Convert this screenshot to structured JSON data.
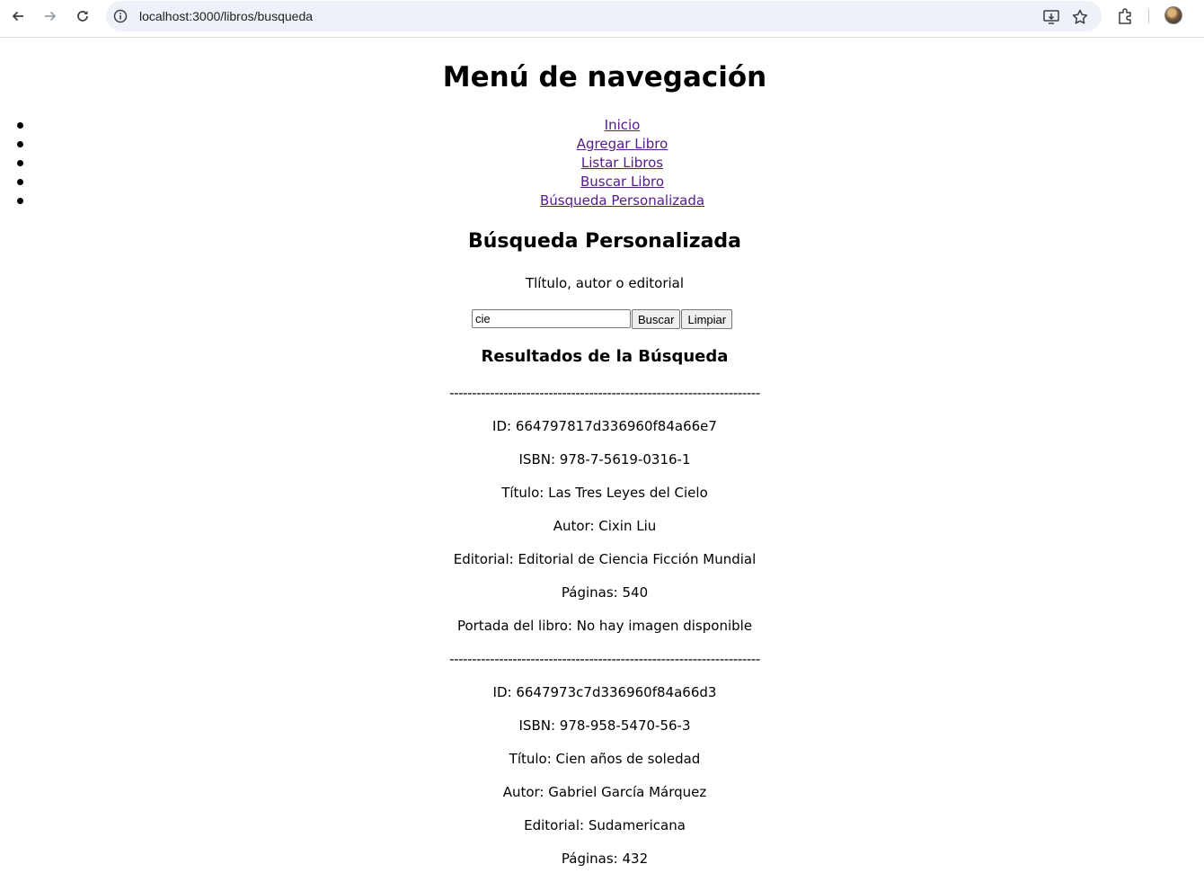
{
  "browser": {
    "url": "localhost:3000/libros/busqueda"
  },
  "page": {
    "title": "Menú de navegación",
    "nav": [
      {
        "label": "Inicio"
      },
      {
        "label": "Agregar Libro"
      },
      {
        "label": "Listar Libros"
      },
      {
        "label": "Buscar Libro"
      },
      {
        "label": "Búsqueda Personalizada"
      }
    ],
    "section_title": "Búsqueda Personalizada",
    "search_hint": "Tlítulo, autor o editorial",
    "search": {
      "value": "cie",
      "buscar_label": "Buscar",
      "limpiar_label": "Limpiar"
    },
    "results_title": "Resultados de la Búsqueda",
    "separator": "---------------------------------------------------------------------",
    "results": [
      {
        "id": "ID: 664797817d336960f84a66e7",
        "isbn": "ISBN: 978-7-5619-0316-1",
        "titulo": "Título: Las Tres Leyes del Cielo",
        "autor": "Autor: Cixin Liu",
        "editorial": "Editorial: Editorial de Ciencia Ficción Mundial",
        "paginas": "Páginas: 540",
        "portada": "Portada del libro: No hay imagen disponible"
      },
      {
        "id": "ID: 6647973c7d336960f84a66d3",
        "isbn": "ISBN: 978-958-5470-56-3",
        "titulo": "Título: Cien años de soledad",
        "autor": "Autor: Gabriel García Márquez",
        "editorial": "Editorial: Sudamericana",
        "paginas": "Páginas: 432"
      }
    ]
  }
}
